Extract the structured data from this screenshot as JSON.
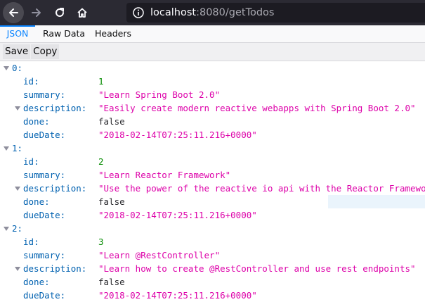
{
  "browser": {
    "url_host": "localhost",
    "url_rest": ":8080/getTodos"
  },
  "viewer": {
    "tabs": [
      {
        "label": "JSON",
        "active": true
      },
      {
        "label": "Raw Data",
        "active": false
      },
      {
        "label": "Headers",
        "active": false
      }
    ],
    "toolbar": {
      "save_label": "Save",
      "copy_label": "Copy"
    }
  },
  "json": {
    "keys": {
      "id": "id:",
      "summary": "summary:",
      "description": "description:",
      "done": "done:",
      "dueDate": "dueDate:"
    },
    "items": [
      {
        "index": "0:",
        "id": "1",
        "summary": "\"Learn Spring Boot 2.0\"",
        "description": "\"Easily create modern reactive webapps with Spring Boot 2.0\"",
        "done": "false",
        "dueDate": "\"2018-02-14T07:25:11.216+0000\""
      },
      {
        "index": "1:",
        "id": "2",
        "summary": "\"Learn Reactor Framework\"",
        "description": "\"Use the power of the reactive io api with the Reactor Framework\"",
        "done": "false",
        "dueDate": "\"2018-02-14T07:25:11.216+0000\""
      },
      {
        "index": "2:",
        "id": "3",
        "summary": "\"Learn @RestController\"",
        "description": "\"Learn how to create @RestController and use rest endpoints\"",
        "done": "false",
        "dueDate": "\"2018-02-14T07:25:11.216+0000\""
      }
    ]
  }
}
